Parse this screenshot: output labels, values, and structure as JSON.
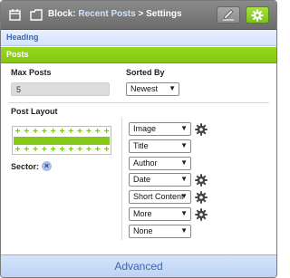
{
  "title_bar": {
    "prefix": "Block:",
    "link": "Recent Posts",
    "separator": ">",
    "suffix": "Settings",
    "icons": [
      "calendar-icon",
      "square-icon",
      "pencil-icon",
      "gear-icon"
    ]
  },
  "tabs": {
    "heading": "Heading",
    "posts": "Posts"
  },
  "form": {
    "max_posts_label": "Max Posts",
    "max_posts_value": "5",
    "sorted_by_label": "Sorted By",
    "sorted_by_value": "Newest",
    "post_layout_label": "Post Layout",
    "sector_label": "Sector:",
    "fields": [
      {
        "value": "Image",
        "has_gear": true
      },
      {
        "value": "Title",
        "has_gear": false
      },
      {
        "value": "Author",
        "has_gear": false
      },
      {
        "value": "Date",
        "has_gear": true
      },
      {
        "value": "Short Content",
        "has_gear": true
      },
      {
        "value": "More",
        "has_gear": true
      },
      {
        "value": "None",
        "has_gear": false
      }
    ]
  },
  "footer": {
    "advanced_label": "Advanced"
  },
  "colors": {
    "accent_green": "#84c612",
    "heading_blue": "#3b66b0",
    "titlebar_gray": "#7a7a7a"
  }
}
